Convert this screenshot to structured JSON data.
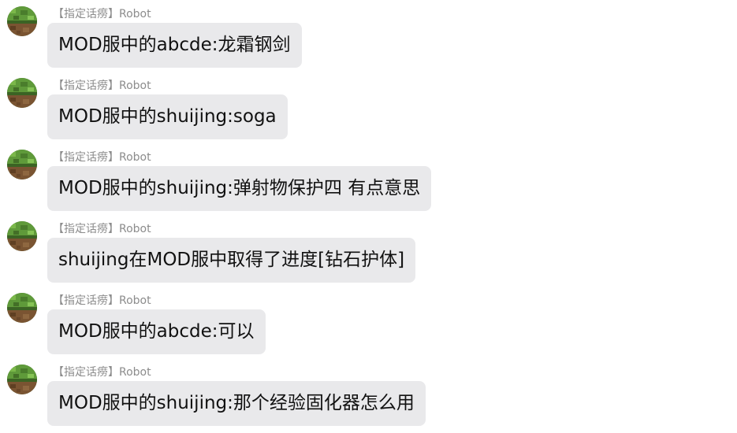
{
  "messages": [
    {
      "tag": "【指定话痨】",
      "sender": "Robot",
      "text": "MOD服中的abcde:龙霜钢剑",
      "avatar_icon": "minecraft-grass-block-icon"
    },
    {
      "tag": "【指定话痨】",
      "sender": "Robot",
      "text": "MOD服中的shuijing:soga",
      "avatar_icon": "minecraft-grass-block-icon"
    },
    {
      "tag": "【指定话痨】",
      "sender": "Robot",
      "text": "MOD服中的shuijing:弹射物保护四 有点意思",
      "avatar_icon": "minecraft-grass-block-icon"
    },
    {
      "tag": "【指定话痨】",
      "sender": "Robot",
      "text": "shuijing在MOD服中取得了进度[钻石护体]",
      "avatar_icon": "minecraft-grass-block-icon"
    },
    {
      "tag": "【指定话痨】",
      "sender": "Robot",
      "text": "MOD服中的abcde:可以",
      "avatar_icon": "minecraft-grass-block-icon"
    },
    {
      "tag": "【指定话痨】",
      "sender": "Robot",
      "text": "MOD服中的shuijing:那个经验固化器怎么用",
      "avatar_icon": "minecraft-grass-block-icon"
    }
  ],
  "colors": {
    "bubble": "#e9e9eb",
    "meta_text": "#8c8c8c",
    "message_text": "#111111"
  }
}
